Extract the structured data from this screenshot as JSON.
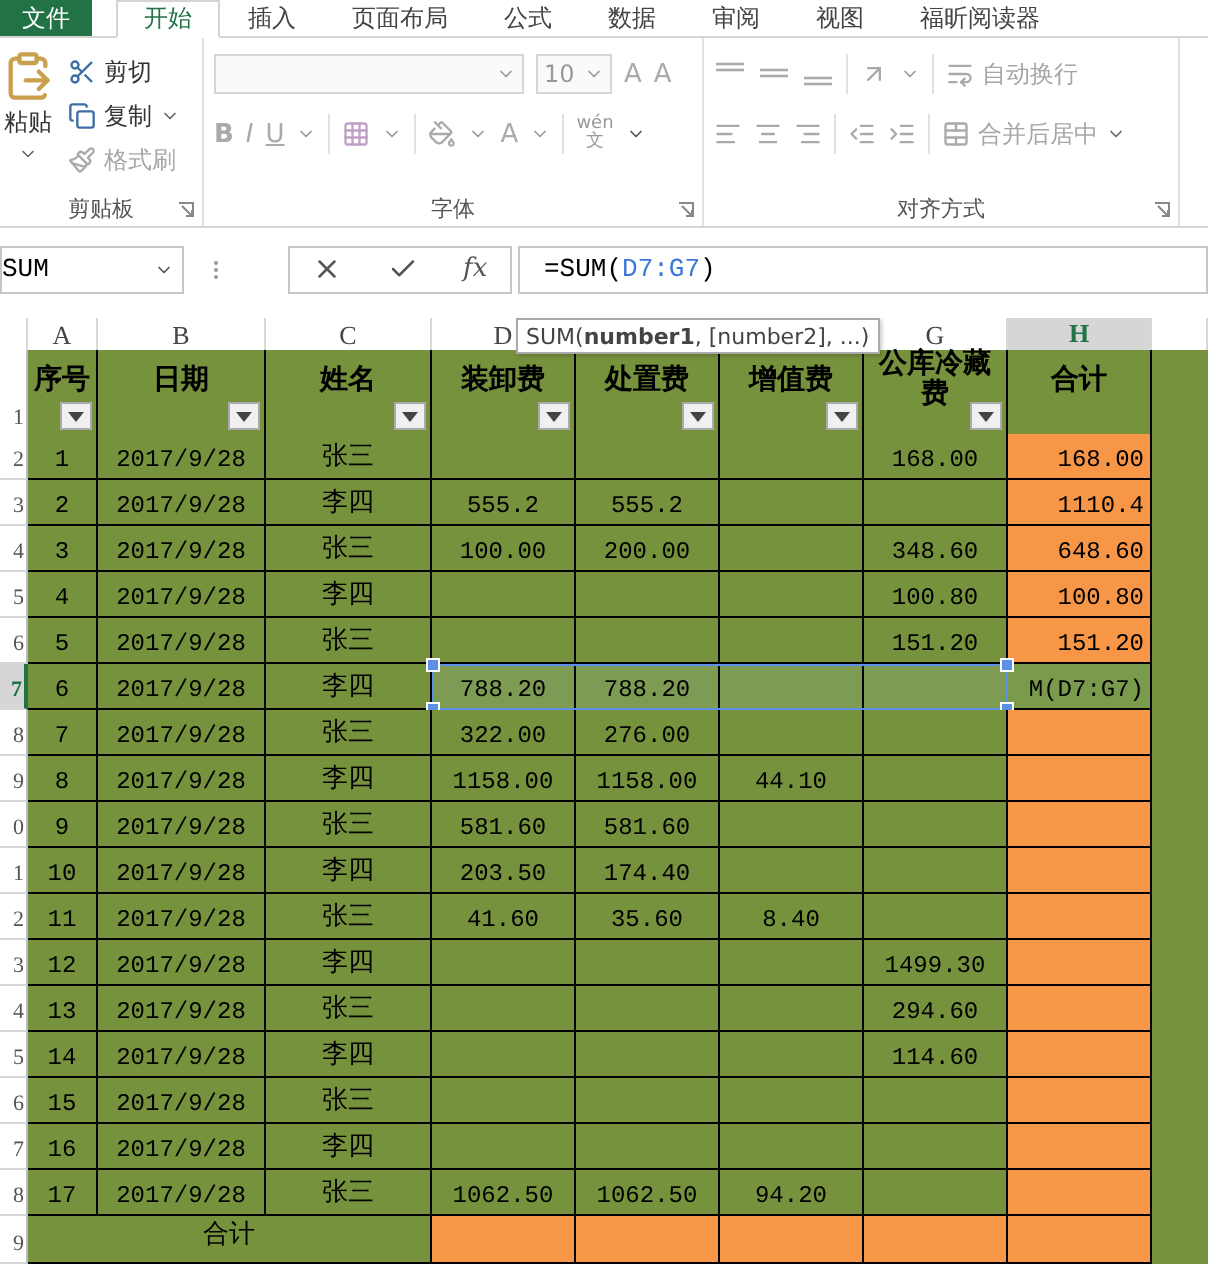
{
  "menu_tabs": [
    {
      "label": "文件",
      "kind": "file",
      "selected": false
    },
    {
      "label": "开始",
      "kind": "tab",
      "selected": true
    },
    {
      "label": "插入",
      "kind": "tab",
      "selected": false
    },
    {
      "label": "页面布局",
      "kind": "tab",
      "selected": false
    },
    {
      "label": "公式",
      "kind": "tab",
      "selected": false
    },
    {
      "label": "数据",
      "kind": "tab",
      "selected": false
    },
    {
      "label": "审阅",
      "kind": "tab",
      "selected": false
    },
    {
      "label": "视图",
      "kind": "tab",
      "selected": false
    },
    {
      "label": "福昕阅读器",
      "kind": "tab",
      "selected": false
    }
  ],
  "clipboard": {
    "paste": "粘贴",
    "label": "剪贴板",
    "items": [
      {
        "label": "剪切",
        "kind": "cut",
        "disabled": false,
        "dropdown": false
      },
      {
        "label": "复制",
        "kind": "copy",
        "disabled": false,
        "dropdown": true
      },
      {
        "label": "格式刷",
        "kind": "painter",
        "disabled": true,
        "dropdown": false
      }
    ]
  },
  "font": {
    "size": "10",
    "grow": "A",
    "shrink": "A",
    "styles": [
      {
        "label": "B",
        "kind": "bold"
      },
      {
        "label": "I",
        "kind": "italic"
      },
      {
        "label": "U",
        "kind": "underline"
      }
    ],
    "font_color": "A",
    "phonetic": {
      "top": "wén",
      "bottom": "文"
    },
    "label": "字体"
  },
  "alignment": {
    "label": "对齐方式",
    "buttons": [
      {
        "label": "自动换行",
        "kind": "wrap",
        "disabled": true,
        "dropdown": false
      },
      {
        "label": "合并后居中",
        "kind": "merge",
        "disabled": true,
        "dropdown": true
      }
    ]
  },
  "formula_bar": {
    "name_box": "SUM",
    "fx": "fx",
    "formula": {
      "prefix": "=SUM(",
      "reference": "D7:G7",
      "suffix": ")"
    }
  },
  "tooltip": {
    "text": "SUM(**number1**, [number2], ...)"
  },
  "columns": [
    {
      "kind": "letter",
      "letter": "A",
      "selected": false
    },
    {
      "kind": "letter",
      "letter": "B",
      "selected": false
    },
    {
      "kind": "letter",
      "letter": "C",
      "selected": false
    },
    {
      "kind": "letter",
      "letter": "D",
      "selected": false
    },
    {
      "kind": "covered"
    },
    {
      "kind": "covered"
    },
    {
      "kind": "letter",
      "letter": "G",
      "selected": false
    },
    {
      "kind": "letter",
      "letter": "H",
      "selected": true
    }
  ],
  "header_row": {
    "row": "1",
    "cells": [
      {
        "label": "序号",
        "filter": true
      },
      {
        "label": "日期",
        "filter": true
      },
      {
        "label": "姓名",
        "filter": true
      },
      {
        "label": "装卸费",
        "filter": true
      },
      {
        "label": "处置费",
        "filter": true
      },
      {
        "label": "增值费",
        "filter": true
      },
      {
        "label": "公库冷藏费",
        "filter": true
      },
      {
        "label": "合计",
        "filter": false
      }
    ]
  },
  "rows": [
    {
      "row": "2",
      "selected": false,
      "cells": [
        "1",
        "2017/9/28",
        "张三",
        null,
        null,
        null,
        "168.00",
        "168.00"
      ]
    },
    {
      "row": "3",
      "selected": false,
      "cells": [
        "2",
        "2017/9/28",
        "李四",
        "555.2",
        "555.2",
        null,
        null,
        "1110.4"
      ]
    },
    {
      "row": "4",
      "selected": false,
      "cells": [
        "3",
        "2017/9/28",
        "张三",
        "100.00",
        "200.00",
        null,
        "348.60",
        "648.60"
      ]
    },
    {
      "row": "5",
      "selected": false,
      "cells": [
        "4",
        "2017/9/28",
        "李四",
        null,
        null,
        null,
        "100.80",
        "100.80"
      ]
    },
    {
      "row": "6",
      "selected": false,
      "cells": [
        "5",
        "2017/9/28",
        "张三",
        null,
        null,
        null,
        "151.20",
        "151.20"
      ]
    },
    {
      "row": "7",
      "selected": true,
      "cells": [
        "6",
        "2017/9/28",
        "李四",
        "788.20",
        "788.20",
        null,
        null,
        "M(D7:G7)"
      ]
    },
    {
      "row": "8",
      "selected": false,
      "cells": [
        "7",
        "2017/9/28",
        "张三",
        "322.00",
        "276.00",
        null,
        null,
        null
      ]
    },
    {
      "row": "9",
      "selected": false,
      "cells": [
        "8",
        "2017/9/28",
        "李四",
        "1158.00",
        "1158.00",
        "44.10",
        null,
        null
      ]
    },
    {
      "row": "0",
      "selected": false,
      "cells": [
        "9",
        "2017/9/28",
        "张三",
        "581.60",
        "581.60",
        null,
        null,
        null
      ]
    },
    {
      "row": "1",
      "selected": false,
      "cells": [
        "10",
        "2017/9/28",
        "李四",
        "203.50",
        "174.40",
        null,
        null,
        null
      ]
    },
    {
      "row": "2",
      "selected": false,
      "cells": [
        "11",
        "2017/9/28",
        "张三",
        "41.60",
        "35.60",
        "8.40",
        null,
        null
      ]
    },
    {
      "row": "3",
      "selected": false,
      "cells": [
        "12",
        "2017/9/28",
        "李四",
        null,
        null,
        null,
        "1499.30",
        null
      ]
    },
    {
      "row": "4",
      "selected": false,
      "cells": [
        "13",
        "2017/9/28",
        "张三",
        null,
        null,
        null,
        "294.60",
        null
      ]
    },
    {
      "row": "5",
      "selected": false,
      "cells": [
        "14",
        "2017/9/28",
        "李四",
        null,
        null,
        null,
        "114.60",
        null
      ]
    },
    {
      "row": "6",
      "selected": false,
      "cells": [
        "15",
        "2017/9/28",
        "张三",
        null,
        null,
        null,
        null,
        null
      ]
    },
    {
      "row": "7",
      "selected": false,
      "cells": [
        "16",
        "2017/9/28",
        "李四",
        null,
        null,
        null,
        null,
        null
      ]
    },
    {
      "row": "8",
      "selected": false,
      "cells": [
        "17",
        "2017/9/28",
        "张三",
        "1062.50",
        "1062.50",
        "94.20",
        null,
        null
      ]
    }
  ],
  "total_row": {
    "row": "9",
    "label": "合计"
  }
}
